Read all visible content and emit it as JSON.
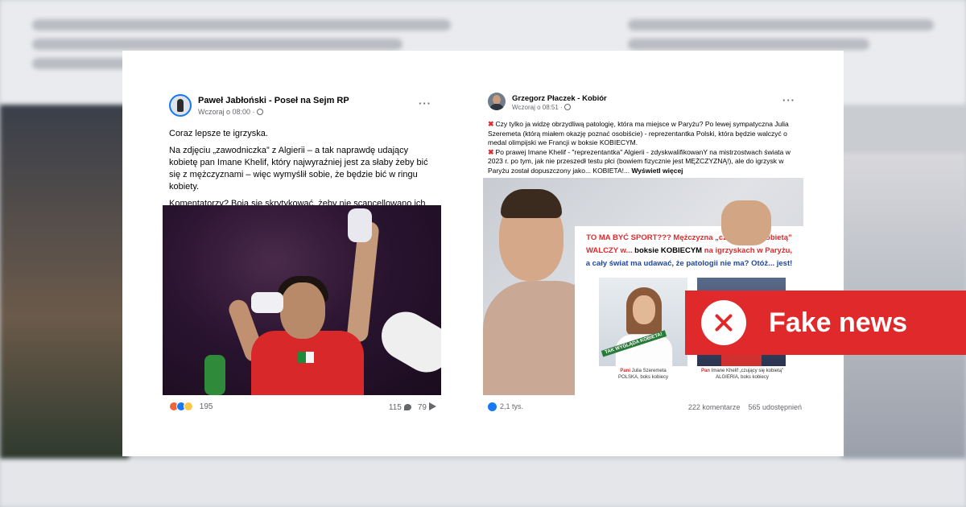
{
  "left_post": {
    "author": "Paweł Jabłoński - Poseł na Sejm RP",
    "time": "Wczoraj o 08:00 ·",
    "more": "···",
    "paragraphs": [
      "Coraz lepsze te igrzyska.",
      "Na zdjęciu „zawodniczka” z Algierii – a tak naprawdę udający kobietę pan Imane Khelif, który najwyraźniej jest za słaby żeby bić się z mężczyznami – więc wymyślił sobie, że będzie bić w ringu kobiety.",
      "Komentatorzy? Boją się skrytykować, żeby nie scancellowano ich za tzw. „transfobię”."
    ],
    "reaction_count": "195",
    "comments": "115",
    "shares": "79"
  },
  "right_post": {
    "author": "Grzegorz Płaczek - Kobiór",
    "time": "Wczoraj o 08:51 ·",
    "more": "···",
    "line1": "Czy tylko ja widzę obrzydliwą patologię, która ma miejsce w Paryżu? Po lewej sympatyczna Julia Szeremeta (którą miałem okazję poznać osobiście) - reprezentantka Polski, która będzie walczyć o medal olimpijski we Francji w boksie KOBIECYM.",
    "line2": "Po prawej Imane Khelif - \"reprezentantka\" Algierii - zdyskwalifikowanY na mistrzostwach świata w 2023 r. po tym, jak nie przeszedł testu płci (bowiem fizycznie jest MĘŻCZYZNĄ!), ale do igrzysk w Paryżu został dopuszczony jako... KOBIETA!...",
    "see_more": "Wyświetl więcej",
    "graphic": {
      "l1": "TO MA BYĆ SPORT??? Mężczyzna „czujący się kobietą”",
      "l2a": "WALCZY w...",
      "l2b": " boksie KOBIECYM",
      "l2c": " na igrzyskach w Paryżu,",
      "l3": "a cały świat ma udawać, że patologii nie ma? Otóż... jest!",
      "tag": "TAK WYGLĄDA KOBIETA!",
      "cap1_prefix": "Pani",
      "cap1_name": " Julia Szeremeta",
      "cap1_sub": "POLSKA, boks kobiecy",
      "cap2_prefix": "Pan",
      "cap2_name": " Imane Khelif „czujący się kobietą”",
      "cap2_sub": "ALGIERIA, boks kobiecy"
    },
    "likes": "2,1 tys.",
    "comments": "222 komentarze",
    "shares": "565 udostępnień"
  },
  "badge": {
    "label": "Fake news",
    "color": "#e0292b",
    "icon": "close-circle-icon"
  }
}
